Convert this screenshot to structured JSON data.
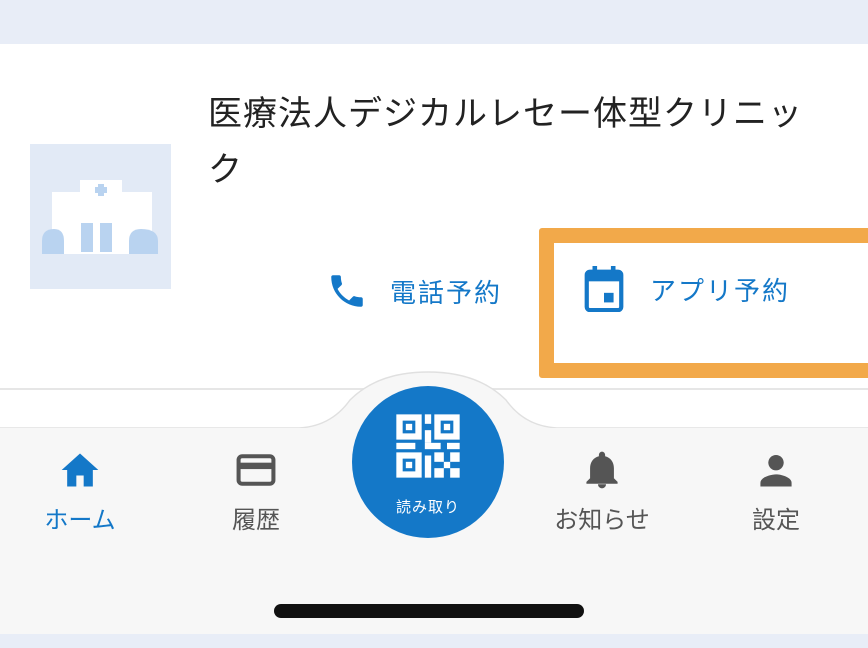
{
  "clinic": {
    "name": "医療法人デジカルレセー体型クリニック"
  },
  "actions": {
    "phone_label": "電話予約",
    "app_label": "アプリ予約"
  },
  "center_button": {
    "label": "読み取り",
    "icon": "qr-code-icon"
  },
  "tabs": [
    {
      "label": "ホーム",
      "icon": "home-icon",
      "active": true
    },
    {
      "label": "履歴",
      "icon": "card-icon",
      "active": false
    },
    {
      "label": "お知らせ",
      "icon": "bell-icon",
      "active": false
    },
    {
      "label": "設定",
      "icon": "person-icon",
      "active": false
    }
  ],
  "colors": {
    "accent": "#1478c8",
    "highlight": "#f2a94a",
    "inactive": "#555555"
  }
}
